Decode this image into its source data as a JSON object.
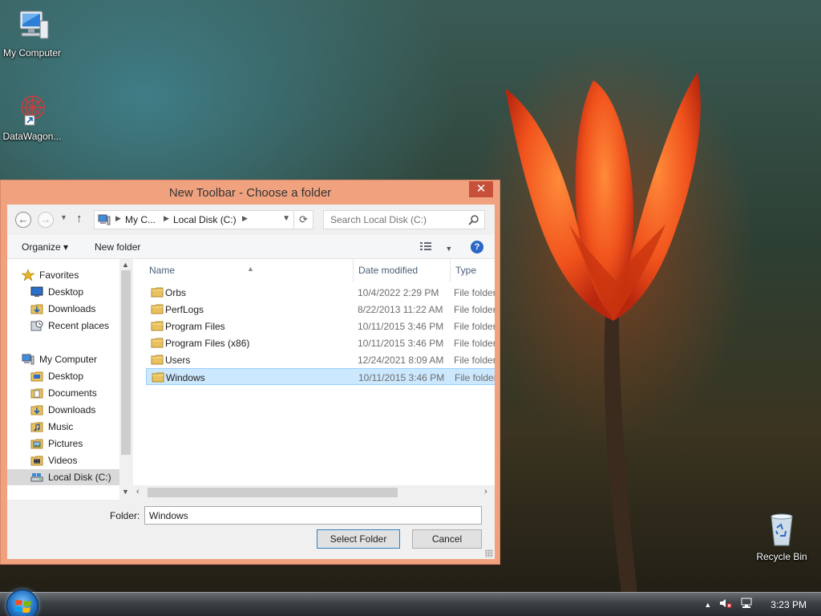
{
  "desktop": {
    "icons": [
      {
        "label": "My Computer"
      },
      {
        "label": "DataWagon..."
      },
      {
        "label": "Recycle Bin"
      }
    ]
  },
  "dialog": {
    "title": "New Toolbar - Choose a folder",
    "close_glyph": "✕",
    "address": {
      "crumbs": [
        "My C...",
        "Local Disk (C:)"
      ],
      "search_placeholder": "Search Local Disk (C:)"
    },
    "commands": {
      "organize": "Organize ▾",
      "new_folder": "New folder",
      "help": "?"
    },
    "nav": {
      "favorites": {
        "label": "Favorites",
        "items": [
          "Desktop",
          "Downloads",
          "Recent places"
        ]
      },
      "computer": {
        "label": "My Computer",
        "items": [
          "Desktop",
          "Documents",
          "Downloads",
          "Music",
          "Pictures",
          "Videos",
          "Local Disk (C:)"
        ]
      },
      "selected": "Local Disk (C:)"
    },
    "columns": [
      "Name",
      "Date modified",
      "Type"
    ],
    "files": [
      {
        "name": "Orbs",
        "date": "10/4/2022 2:29 PM",
        "type": "File folder"
      },
      {
        "name": "PerfLogs",
        "date": "8/22/2013 11:22 AM",
        "type": "File folder"
      },
      {
        "name": "Program Files",
        "date": "10/11/2015 3:46 PM",
        "type": "File folder"
      },
      {
        "name": "Program Files (x86)",
        "date": "10/11/2015 3:46 PM",
        "type": "File folder"
      },
      {
        "name": "Users",
        "date": "12/24/2021 8:09 AM",
        "type": "File folder"
      },
      {
        "name": "Windows",
        "date": "10/11/2015 3:46 PM",
        "type": "File folder"
      }
    ],
    "selected_file": "Windows",
    "folder_label": "Folder:",
    "folder_value": "Windows",
    "buttons": {
      "select": "Select Folder",
      "cancel": "Cancel"
    }
  },
  "taskbar": {
    "clock": "3:23 PM"
  },
  "icons": {
    "folder": "folder-icon",
    "computer": "computer-icon",
    "volume": "muted-volume-icon",
    "network": "network-icon"
  },
  "colors": {
    "dialog_frame": "#f0a27f",
    "close_button": "#c7503a",
    "selection": "#cce8ff"
  }
}
